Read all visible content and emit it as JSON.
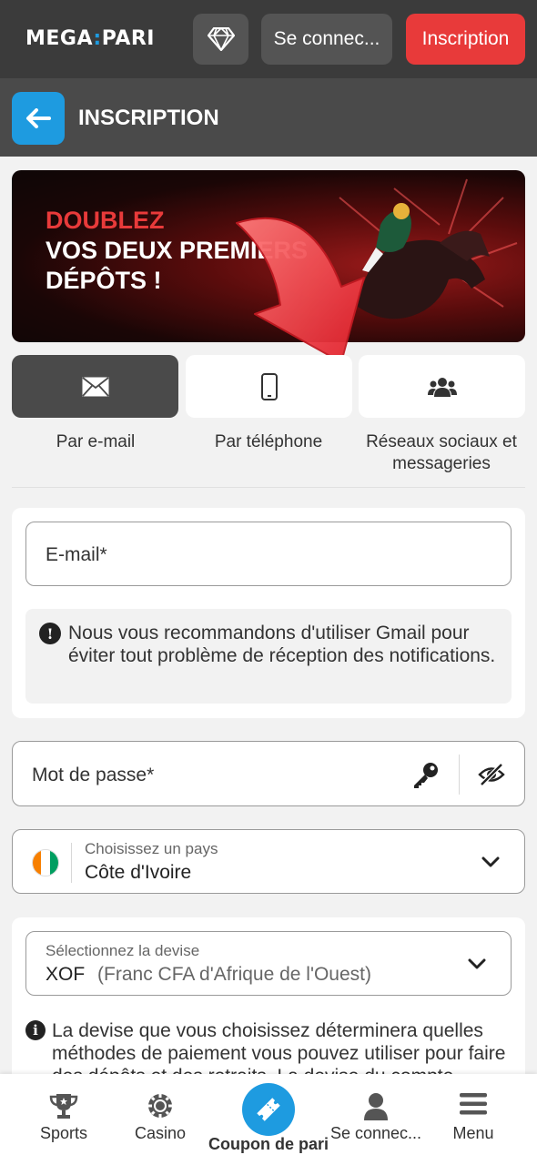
{
  "header": {
    "logo_left": "MEGA",
    "logo_right": "PARI",
    "vip_icon": "diamond-icon",
    "login_label": "Se connec...",
    "register_label": "Inscription"
  },
  "subheader": {
    "back_icon": "arrow-left-icon",
    "title": "INSCRIPTION"
  },
  "banner": {
    "line1": "DOUBLEZ",
    "line2": "VOS DEUX PREMIERS",
    "line3": "DÉPÔTS !"
  },
  "tabs": [
    {
      "label": "Par e-mail",
      "icon": "envelope-icon",
      "active": true
    },
    {
      "label": "Par téléphone",
      "icon": "phone-icon",
      "active": false
    },
    {
      "label": "Réseaux sociaux et messageries",
      "icon": "users-icon",
      "active": false
    }
  ],
  "email_card": {
    "email_placeholder": "E-mail*",
    "notice": "Nous vous recommandons d'utiliser Gmail pour éviter tout problème de réception des notifications."
  },
  "password": {
    "placeholder": "Mot de passe*",
    "generate_icon": "key-icon",
    "visibility_icon": "eye-slash-icon"
  },
  "country": {
    "label": "Choisissez un pays",
    "value": "Côte d'Ivoire",
    "flag_colors": [
      "#f77f00",
      "#ffffff",
      "#009e60"
    ]
  },
  "currency": {
    "label": "Sélectionnez la devise",
    "code": "XOF",
    "name": "(Franc CFA d'Afrique de l'Ouest)",
    "notice": "La devise que vous choisissez déterminera quelles méthodes de paiement vous pouvez utiliser pour faire des dépôts et des retraits. La devise du compte"
  },
  "bottom_nav": [
    {
      "label": "Sports",
      "icon": "trophy-icon"
    },
    {
      "label": "Casino",
      "icon": "casino-chip-icon"
    },
    {
      "label": "Coupon de pari",
      "icon": "ticket-icon"
    },
    {
      "label": "Se connec...",
      "icon": "user-icon"
    },
    {
      "label": "Menu",
      "icon": "hamburger-icon"
    }
  ],
  "colors": {
    "accent_blue": "#1e9be0",
    "register_red": "#e83a3a",
    "topbar": "#3b3b3b"
  }
}
